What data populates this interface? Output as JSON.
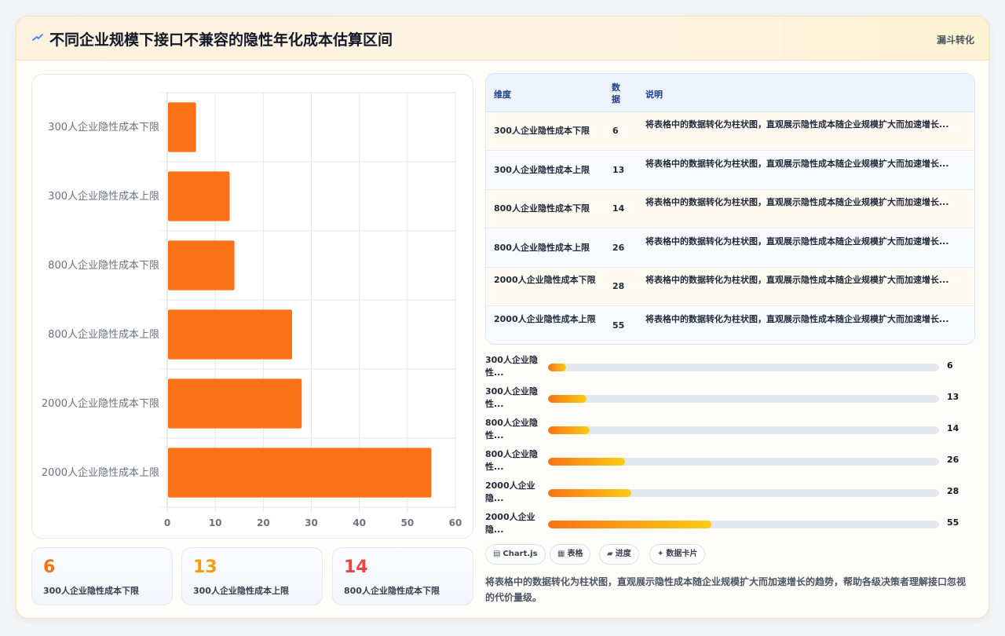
{
  "header": {
    "title": "不同企业规模下接口不兼容的隐性年化成本估算区间",
    "tag": "漏斗转化"
  },
  "colors": {
    "bar": "#f97316",
    "stat_values": [
      "#f97316",
      "#f59e0b",
      "#ef4444"
    ]
  },
  "chart_data": {
    "type": "bar",
    "orientation": "horizontal",
    "categories": [
      "300人企业隐性成本下限",
      "300人企业隐性成本上限",
      "800人企业隐性成本下限",
      "800人企业隐性成本上限",
      "2000人企业隐性成本下限",
      "2000人企业隐性成本上限"
    ],
    "values": [
      6,
      13,
      14,
      26,
      28,
      55
    ],
    "xlim": [
      0,
      60
    ],
    "xticks": [
      "0",
      "10",
      "20",
      "30",
      "40",
      "50",
      "60"
    ],
    "grid": true,
    "legend": "none"
  },
  "stats": [
    {
      "value": "6",
      "label": "300人企业隐性成本下限"
    },
    {
      "value": "13",
      "label": "300人企业隐性成本上限"
    },
    {
      "value": "14",
      "label": "800人企业隐性成本下限"
    }
  ],
  "table": {
    "headers": [
      "维度",
      "数据",
      "说明"
    ],
    "rows": [
      [
        "300人企业隐性成本下限",
        "6",
        "将表格中的数据转化为柱状图，直观展示隐性成本随企业规模扩大而加速增长..."
      ],
      [
        "300人企业隐性成本上限",
        "13",
        "将表格中的数据转化为柱状图，直观展示隐性成本随企业规模扩大而加速增长..."
      ],
      [
        "800人企业隐性成本下限",
        "14",
        "将表格中的数据转化为柱状图，直观展示隐性成本随企业规模扩大而加速增长..."
      ],
      [
        "800人企业隐性成本上限",
        "26",
        "将表格中的数据转化为柱状图，直观展示隐性成本随企业规模扩大而加速增长..."
      ],
      [
        "2000人企业隐性成本下限",
        "28",
        "将表格中的数据转化为柱状图，直观展示隐性成本随企业规模扩大而加速增长..."
      ],
      [
        "2000人企业隐性成本上限",
        "55",
        "将表格中的数据转化为柱状图，直观展示隐性成本随企业规模扩大而加速增长..."
      ]
    ]
  },
  "progress": {
    "max": 55,
    "items": [
      {
        "label": "300人企业隐性...",
        "value": 6,
        "display": "6"
      },
      {
        "label": "300人企业隐性...",
        "value": 13,
        "display": "13"
      },
      {
        "label": "800人企业隐性...",
        "value": 14,
        "display": "14"
      },
      {
        "label": "800人企业隐性...",
        "value": 26,
        "display": "26"
      },
      {
        "label": "2000人企业隐...",
        "value": 28,
        "display": "28"
      },
      {
        "label": "2000人企业隐...",
        "value": 55,
        "display": "55"
      }
    ]
  },
  "chips": [
    {
      "icon": "▤",
      "icon_name": "chart-icon",
      "label": "Chart.js"
    },
    {
      "icon": "▦",
      "icon_name": "table-icon",
      "label": "表格"
    },
    {
      "icon": "▰",
      "icon_name": "progress-icon",
      "label": "进度"
    },
    {
      "icon": "✦",
      "icon_name": "card-icon",
      "label": "数据卡片"
    }
  ],
  "description": "将表格中的数据转化为柱状图，直观展示隐性成本随企业规模扩大而加速增长的趋势，帮助各级决策者理解接口忽视的代价量级。"
}
